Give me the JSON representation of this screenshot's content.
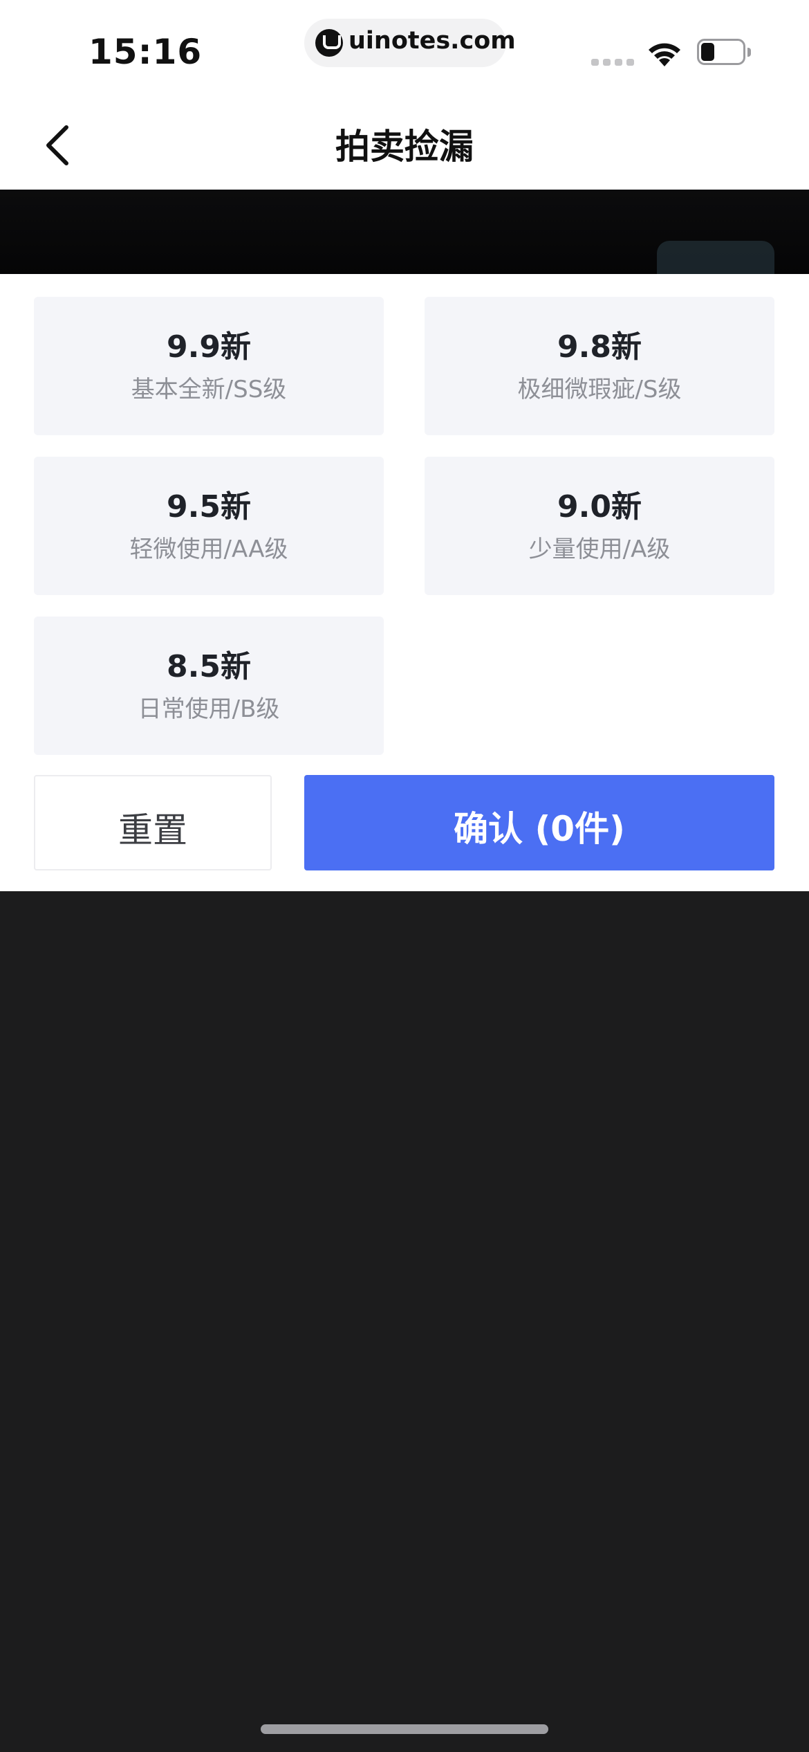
{
  "status_bar": {
    "time": "15:16",
    "url": "uinotes.com",
    "battery_level": 0.25
  },
  "nav": {
    "title": "拍卖捡漏"
  },
  "condition_options": [
    {
      "grade": "9.9新",
      "desc": "基本全新/SS级"
    },
    {
      "grade": "9.8新",
      "desc": "极细微瑕疵/S级"
    },
    {
      "grade": "9.5新",
      "desc": "轻微使用/AA级"
    },
    {
      "grade": "9.0新",
      "desc": "少量使用/A级"
    },
    {
      "grade": "8.5新",
      "desc": "日常使用/B级"
    }
  ],
  "actions": {
    "reset_label": "重置",
    "confirm_label": "确认 (0件)"
  },
  "colors": {
    "accent": "#4b6ff3",
    "card_bg": "#f4f5f9",
    "overlay": "#1c1c1d"
  }
}
